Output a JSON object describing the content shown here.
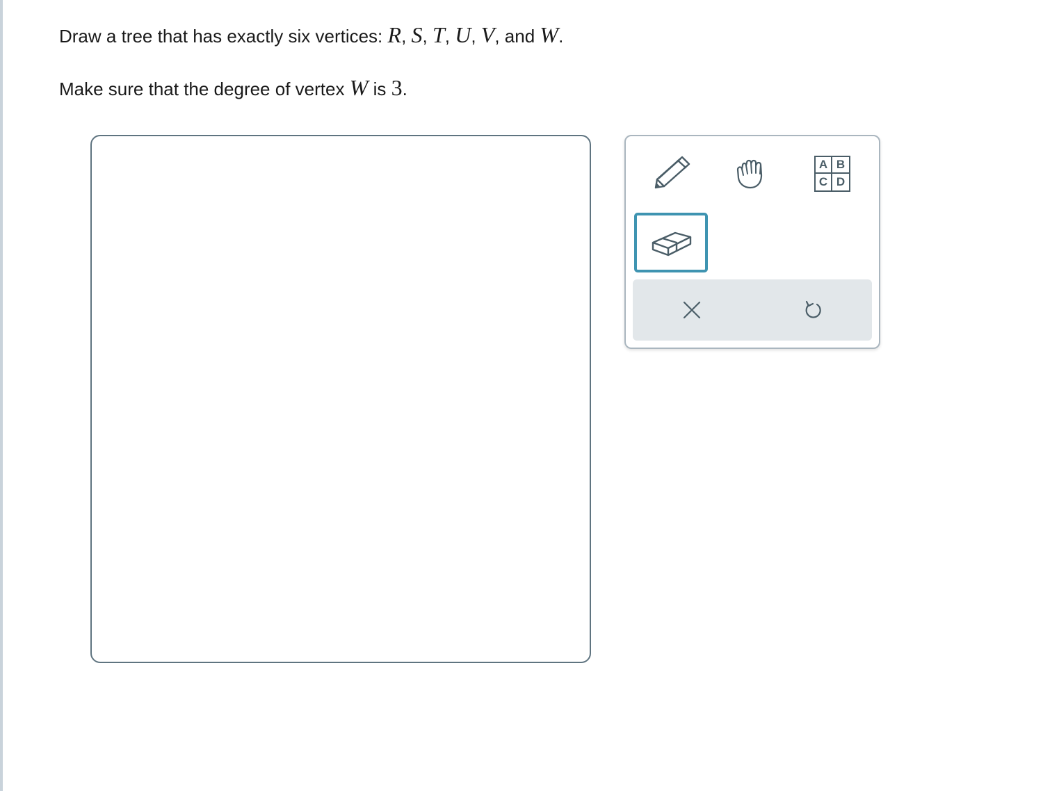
{
  "prompt": {
    "line1": {
      "text": "Draw a tree that has exactly six vertices:",
      "vertices": [
        "R",
        "S",
        "T",
        "U",
        "V"
      ],
      "conjunction": "and",
      "last_vertex": "W",
      "end": "."
    },
    "line2": {
      "text_before": "Make sure that the degree of vertex",
      "vertex": "W",
      "text_mid": "is",
      "value": "3",
      "end": "."
    }
  },
  "toolbox": {
    "tools": [
      {
        "name": "pencil",
        "icon": "pencil-icon",
        "selected": false
      },
      {
        "name": "hand",
        "icon": "hand-icon",
        "selected": false
      },
      {
        "name": "label",
        "icon": "abcd-label-icon",
        "selected": false
      },
      {
        "name": "eraser",
        "icon": "eraser-icon",
        "selected": true
      }
    ],
    "label_icon_letters": [
      "A",
      "B",
      "C",
      "D"
    ],
    "actions": [
      {
        "name": "clear",
        "icon": "close-icon"
      },
      {
        "name": "undo",
        "icon": "undo-icon"
      }
    ]
  },
  "colors": {
    "accent": "#3f94b1",
    "icon": "#4a5d67",
    "canvas_border": "#5f7480",
    "action_bar": "#e2e7ea"
  }
}
